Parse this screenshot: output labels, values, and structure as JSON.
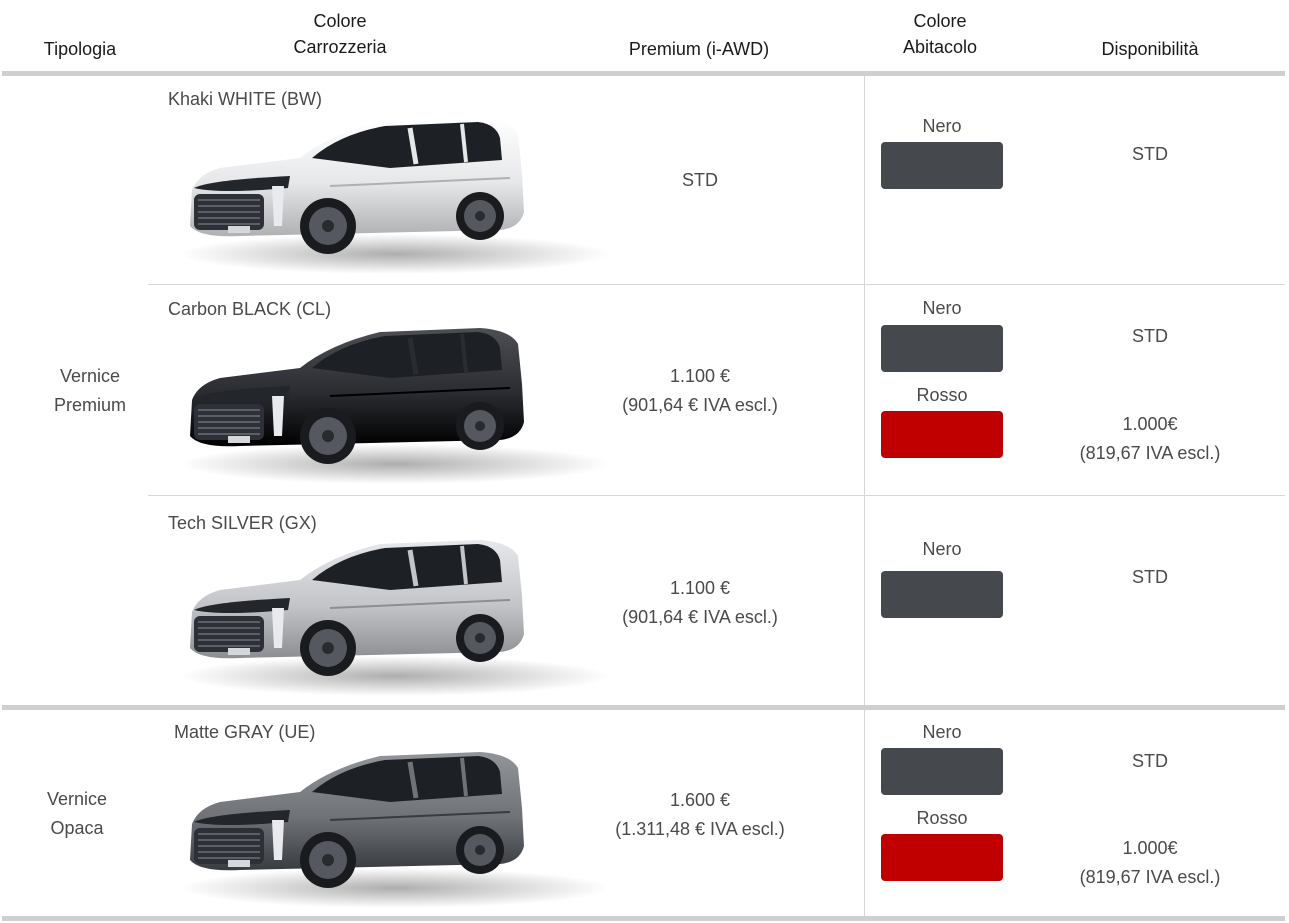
{
  "headers": {
    "tipologia": "Tipologia",
    "colore_carrozzeria_1": "Colore",
    "colore_carrozzeria_2": "Carrozzeria",
    "premium": "Premium (i-AWD)",
    "colore_abitacolo_1": "Colore",
    "colore_abitacolo_2": "Abitacolo",
    "disponibilita": "Disponibilità"
  },
  "groups": [
    {
      "line1": "Vernice",
      "line2": "Premium"
    },
    {
      "line1": "Vernice",
      "line2": "Opaca"
    }
  ],
  "rows": [
    {
      "color_name": "Khaki WHITE (BW)",
      "car_color": "#e6e7e9",
      "price_line1": "STD",
      "price_line2": "",
      "interiors": [
        {
          "label": "Nero",
          "color": "#45484d",
          "availability_1": "STD",
          "availability_2": ""
        }
      ]
    },
    {
      "color_name": "Carbon BLACK (CL)",
      "car_color": "#2a2c31",
      "price_line1": "1.100 €",
      "price_line2": "(901,64 € IVA escl.)",
      "interiors": [
        {
          "label": "Nero",
          "color": "#45484d",
          "availability_1": "STD",
          "availability_2": ""
        },
        {
          "label": "Rosso",
          "color": "#c00000",
          "availability_1": "1.000€",
          "availability_2": "(819,67 IVA escl.)"
        }
      ]
    },
    {
      "color_name": "Tech SILVER (GX)",
      "car_color": "#c3c5c9",
      "price_line1": "1.100 €",
      "price_line2": "(901,64 € IVA escl.)",
      "interiors": [
        {
          "label": "Nero",
          "color": "#45484d",
          "availability_1": "STD",
          "availability_2": ""
        }
      ]
    },
    {
      "color_name": "Matte GRAY (UE)",
      "car_color": "#6f7277",
      "price_line1": "1.600 €",
      "price_line2": "(1.311,48 € IVA escl.)",
      "interiors": [
        {
          "label": "Nero",
          "color": "#45484d",
          "availability_1": "STD",
          "availability_2": ""
        },
        {
          "label": "Rosso",
          "color": "#c00000",
          "availability_1": "1.000€",
          "availability_2": "(819,67 IVA escl.)"
        }
      ]
    }
  ]
}
